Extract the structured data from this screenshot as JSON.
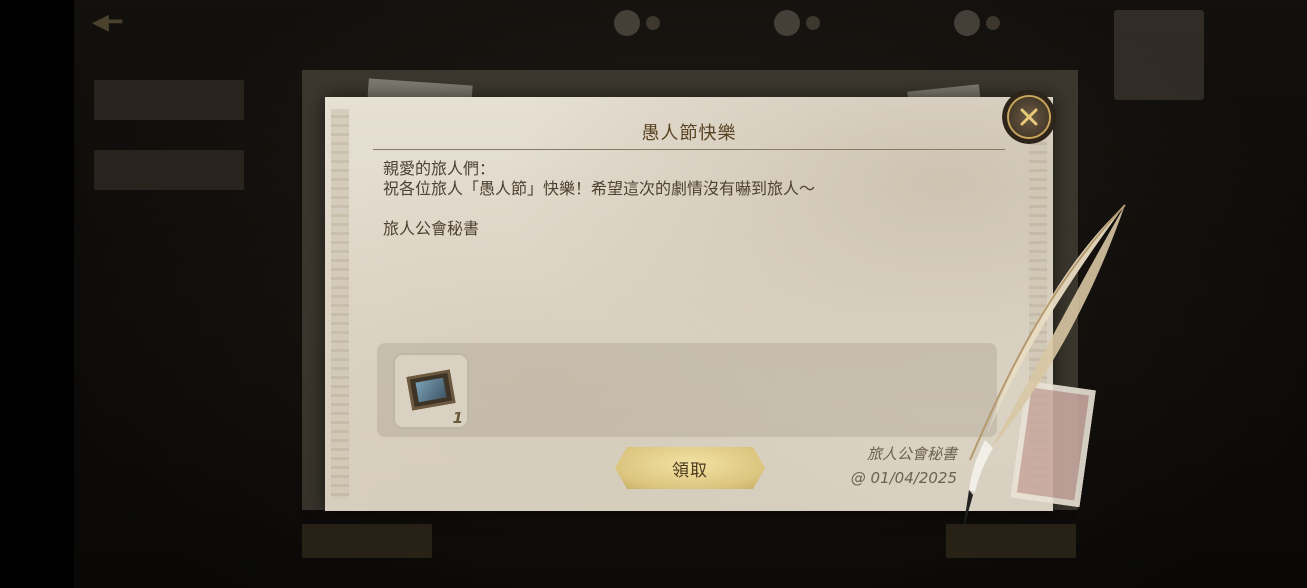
{
  "letter": {
    "title": "愚人節快樂",
    "lines": [
      "親愛的旅人們：",
      "祝各位旅人「愚人節」快樂！希望這次的劇情沒有嚇到旅人～",
      "",
      "旅人公會秘書"
    ],
    "reward": {
      "count": "1",
      "icon": "framed-portrait-icon"
    },
    "claim_label": "領取",
    "signature": {
      "name": "旅人公會秘書",
      "date": "@ 01/04/2025"
    }
  },
  "colors": {
    "title": "#5a4322",
    "body_text": "#4e4232",
    "button_gold": "#dcc57f",
    "close_ring": "#c9a65a"
  }
}
